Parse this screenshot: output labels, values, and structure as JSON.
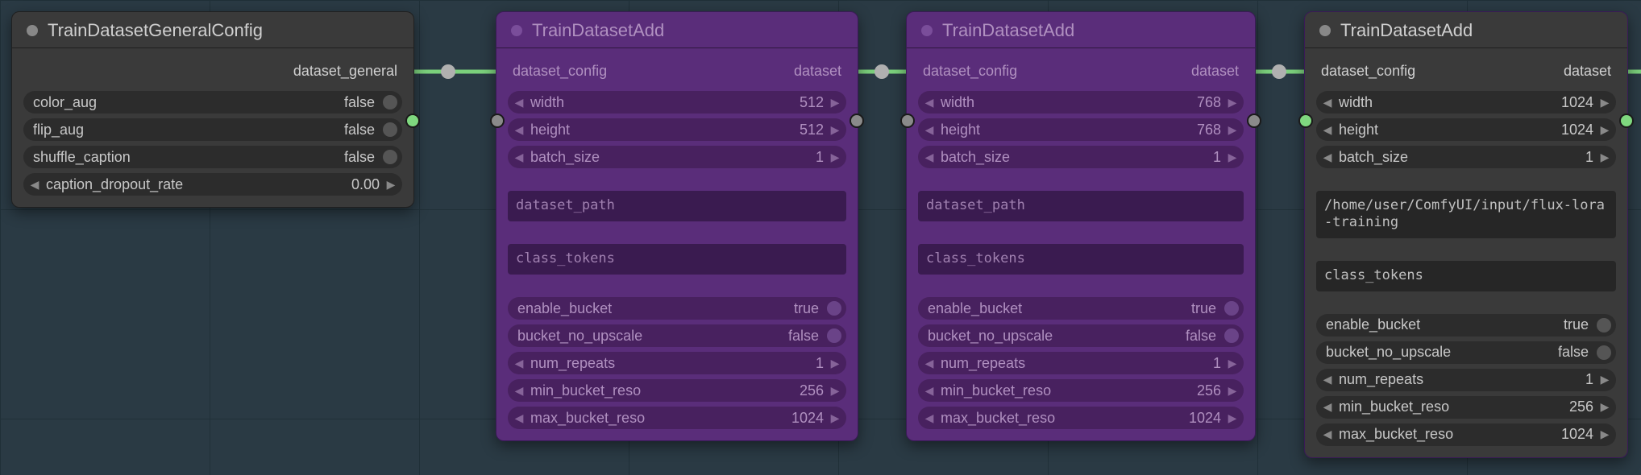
{
  "nodes": {
    "gen": {
      "title": "TrainDatasetGeneralConfig",
      "out_label": "dataset_general",
      "fields": {
        "color_aug": {
          "label": "color_aug",
          "value": "false"
        },
        "flip_aug": {
          "label": "flip_aug",
          "value": "false"
        },
        "shuffle_caption": {
          "label": "shuffle_caption",
          "value": "false"
        },
        "caption_dropout_rate": {
          "label": "caption_dropout_rate",
          "value": "0.00"
        }
      }
    },
    "add1": {
      "title": "TrainDatasetAdd",
      "in_label": "dataset_config",
      "out_label": "dataset",
      "fields": {
        "width": {
          "label": "width",
          "value": "512"
        },
        "height": {
          "label": "height",
          "value": "512"
        },
        "batch_size": {
          "label": "batch_size",
          "value": "1"
        },
        "dataset_path": {
          "label": "dataset_path",
          "value": ""
        },
        "class_tokens": {
          "label": "class_tokens",
          "value": ""
        },
        "enable_bucket": {
          "label": "enable_bucket",
          "value": "true"
        },
        "bucket_no_upscale": {
          "label": "bucket_no_upscale",
          "value": "false"
        },
        "num_repeats": {
          "label": "num_repeats",
          "value": "1"
        },
        "min_bucket_reso": {
          "label": "min_bucket_reso",
          "value": "256"
        },
        "max_bucket_reso": {
          "label": "max_bucket_reso",
          "value": "1024"
        }
      }
    },
    "add2": {
      "title": "TrainDatasetAdd",
      "in_label": "dataset_config",
      "out_label": "dataset",
      "fields": {
        "width": {
          "label": "width",
          "value": "768"
        },
        "height": {
          "label": "height",
          "value": "768"
        },
        "batch_size": {
          "label": "batch_size",
          "value": "1"
        },
        "dataset_path": {
          "label": "dataset_path",
          "value": ""
        },
        "class_tokens": {
          "label": "class_tokens",
          "value": ""
        },
        "enable_bucket": {
          "label": "enable_bucket",
          "value": "true"
        },
        "bucket_no_upscale": {
          "label": "bucket_no_upscale",
          "value": "false"
        },
        "num_repeats": {
          "label": "num_repeats",
          "value": "1"
        },
        "min_bucket_reso": {
          "label": "min_bucket_reso",
          "value": "256"
        },
        "max_bucket_reso": {
          "label": "max_bucket_reso",
          "value": "1024"
        }
      }
    },
    "add3": {
      "title": "TrainDatasetAdd",
      "in_label": "dataset_config",
      "out_label": "dataset",
      "fields": {
        "width": {
          "label": "width",
          "value": "1024"
        },
        "height": {
          "label": "height",
          "value": "1024"
        },
        "batch_size": {
          "label": "batch_size",
          "value": "1"
        },
        "dataset_path": {
          "label": "dataset_path",
          "value": "/home/user/ComfyUI/input/flux-lora-training"
        },
        "class_tokens": {
          "label": "class_tokens",
          "value": ""
        },
        "enable_bucket": {
          "label": "enable_bucket",
          "value": "true"
        },
        "bucket_no_upscale": {
          "label": "bucket_no_upscale",
          "value": "false"
        },
        "num_repeats": {
          "label": "num_repeats",
          "value": "1"
        },
        "min_bucket_reso": {
          "label": "min_bucket_reso",
          "value": "256"
        },
        "max_bucket_reso": {
          "label": "max_bucket_reso",
          "value": "1024"
        }
      }
    }
  }
}
